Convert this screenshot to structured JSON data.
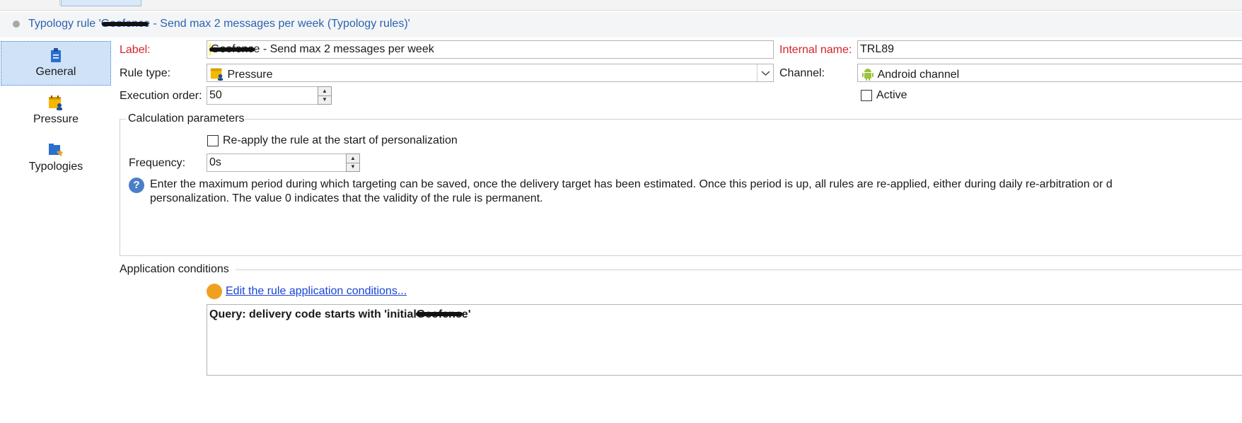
{
  "title": "Typology rule 'Geofence - Send max 2 messages per week (Typology rules)'",
  "nav": [
    {
      "label": "General",
      "icon": "clipboard-icon",
      "selected": true
    },
    {
      "label": "Pressure",
      "icon": "calendar-user-icon",
      "selected": false
    },
    {
      "label": "Typologies",
      "icon": "folder-rule-icon",
      "selected": false
    }
  ],
  "form": {
    "label_caption": "Label:",
    "label_value": "Geofence - Send max 2 messages per week",
    "internal_name_caption": "Internal name:",
    "internal_name_value": "TRL89",
    "rule_type_caption": "Rule type:",
    "rule_type_value": "Pressure",
    "channel_caption": "Channel:",
    "channel_value": "Android channel",
    "execution_order_caption": "Execution order:",
    "execution_order_value": "50",
    "active_label": "Active",
    "active_checked": false
  },
  "calculation": {
    "legend": "Calculation parameters",
    "reapply_label": "Re-apply the rule at the start of personalization",
    "reapply_checked": false,
    "frequency_caption": "Frequency:",
    "frequency_value": "0s",
    "help_line1": "Enter the maximum period during which targeting can be saved, once the delivery target has been estimated. Once this period is up, all rules are re-applied, either during daily re-arbitration or d",
    "help_line2": "personalization. The value 0 indicates that the validity of the rule is permanent."
  },
  "application": {
    "legend": "Application conditions",
    "edit_link": "Edit the rule application conditions...",
    "query": "Query: delivery code starts with 'initialGeofence'"
  },
  "colors": {
    "accent": "#2b63b0",
    "required": "#d4222a",
    "selected_nav": "#cfe2f7",
    "condition_dot": "#f0a020"
  }
}
